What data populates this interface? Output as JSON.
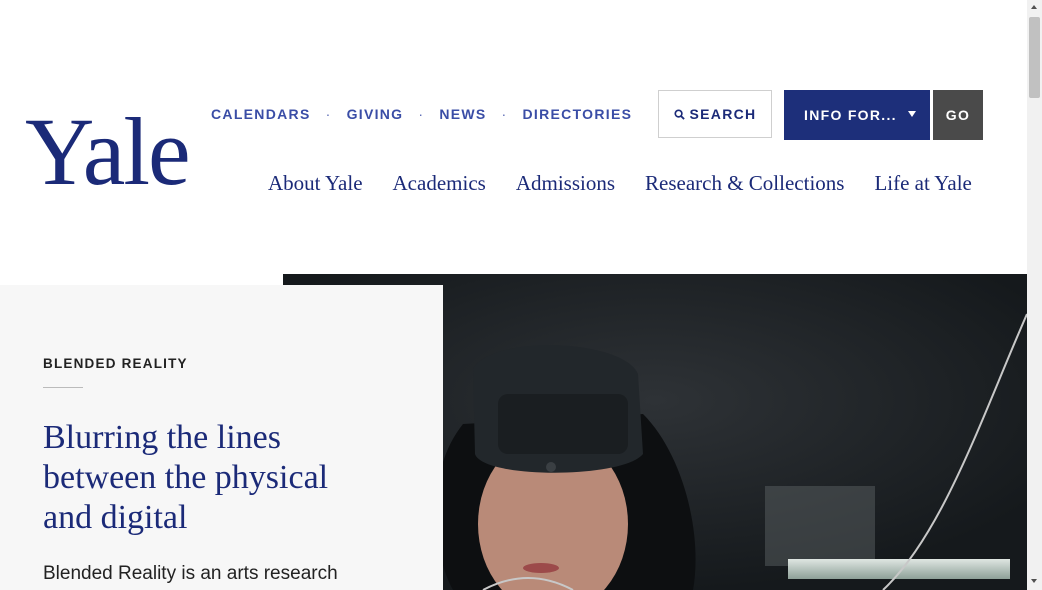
{
  "header": {
    "logo": "Yale",
    "utility_links": [
      "CALENDARS",
      "GIVING",
      "NEWS",
      "DIRECTORIES"
    ],
    "separator": "·",
    "search_label": "SEARCH",
    "info_select_value": "INFO FOR...",
    "go_label": "GO"
  },
  "nav": {
    "items": [
      "About Yale",
      "Academics",
      "Admissions",
      "Research & Collections",
      "Life at Yale"
    ]
  },
  "hero": {
    "eyebrow": "BLENDED REALITY",
    "headline": "Blurring the lines between the physical and digital",
    "blurb": "Blended Reality is an arts research"
  },
  "colors": {
    "brand_blue": "#1b2a78",
    "link_blue": "#3a4da6",
    "info_button": "#1d2f7a",
    "go_button": "#4a4a4a",
    "panel_bg": "#f7f7f7"
  },
  "icons": [
    "search-icon",
    "caret-down-icon"
  ]
}
